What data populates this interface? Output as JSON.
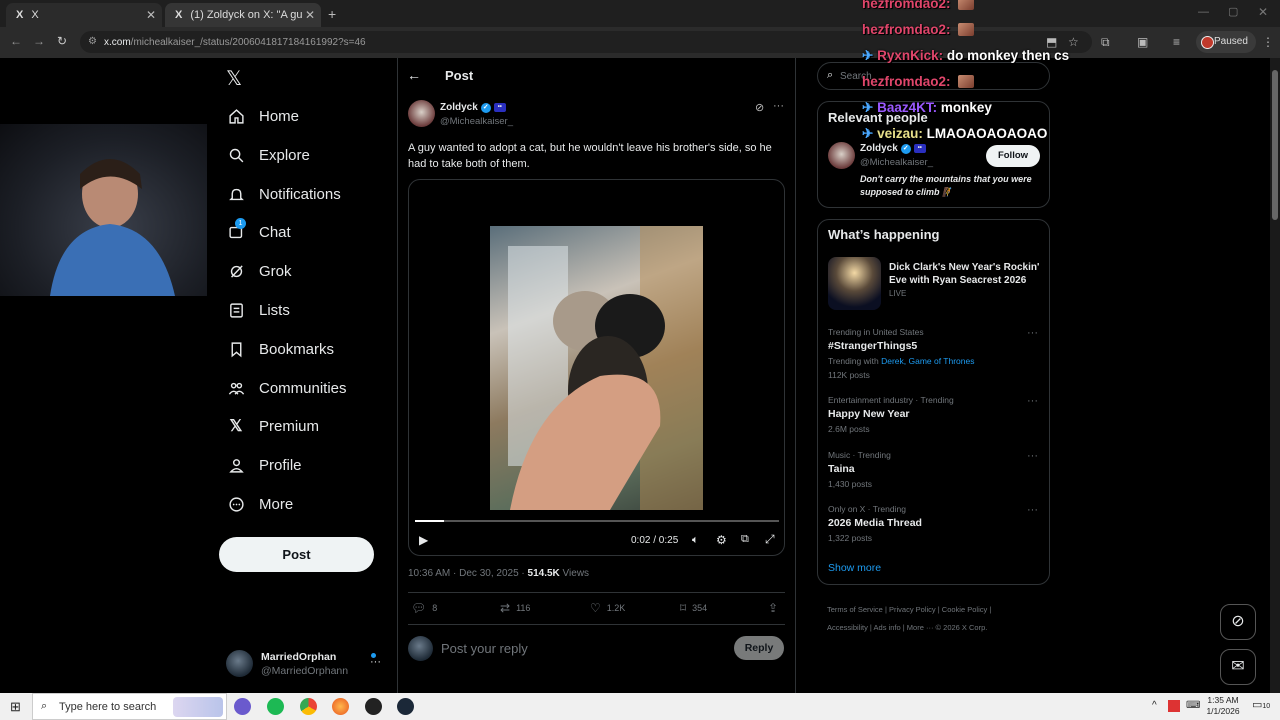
{
  "browser": {
    "tabs": [
      {
        "logo": "X",
        "title": "X",
        "active": false
      },
      {
        "logo": "X",
        "title": "(1) Zoldyck on X: \"A guy wante",
        "active": true
      }
    ],
    "url_host": "x.com",
    "url_path": "/micheal",
    "url_rest": "kaiser_/status/2006041817184161992?s=46",
    "profile_status": "Paused"
  },
  "chat_overlay": [
    {
      "user": "hezfromdao2:",
      "message": "",
      "color": "#e0466b",
      "emote": true,
      "prefix": ""
    },
    {
      "user": "hezfromdao2:",
      "message": "",
      "color": "#e0466b",
      "emote": true,
      "prefix": ""
    },
    {
      "user": "RyxnKick:",
      "message": "do monkey then cs",
      "color": "#e0466b",
      "emote": false,
      "prefix": "✈"
    },
    {
      "user": "hezfromdao2:",
      "message": "",
      "color": "#e0466b",
      "emote": true,
      "prefix": ""
    },
    {
      "user": "Baaz4KT:",
      "message": "monkey",
      "color": "#9b59ff",
      "emote": false,
      "prefix": "✈"
    },
    {
      "user": "veizau:",
      "message": "LMAOAOAOAOAO",
      "color": "#e8e08a",
      "emote": false,
      "prefix": "✈"
    }
  ],
  "sidebar": {
    "logo": "𝕏",
    "items": [
      {
        "label": "Home",
        "icon": "home-icon"
      },
      {
        "label": "Explore",
        "icon": "search-icon"
      },
      {
        "label": "Notifications",
        "icon": "bell-icon"
      },
      {
        "label": "Chat",
        "icon": "chat-icon",
        "badge": "1"
      },
      {
        "label": "Grok",
        "icon": "grok-icon"
      },
      {
        "label": "Lists",
        "icon": "list-icon"
      },
      {
        "label": "Bookmarks",
        "icon": "bookmark-icon"
      },
      {
        "label": "Communities",
        "icon": "communities-icon"
      },
      {
        "label": "Premium",
        "icon": "x-premium-icon"
      },
      {
        "label": "Profile",
        "icon": "profile-icon"
      },
      {
        "label": "More",
        "icon": "more-circle-icon"
      }
    ],
    "post_button": "Post",
    "account": {
      "name": "MarriedOrphan",
      "handle": "@MarriedOrphann"
    }
  },
  "post": {
    "header_title": "Post",
    "author_name": "Zoldyck",
    "author_handle": "@Michealkaiser_",
    "text": "A guy wanted to adopt a cat, but he wouldn't leave his brother's side, so he had to take both of them.",
    "video_time": "0:02 / 0:25",
    "video_progress": 0.08,
    "timestamp": "10:36 AM · Dec 30, 2025 · ",
    "views_count": "514.5K",
    "views_label": "Views",
    "replies": "8",
    "reposts": "116",
    "likes": "1.2K",
    "bookmarks": "354",
    "reply_placeholder": "Post your reply",
    "reply_button": "Reply"
  },
  "right": {
    "search_placeholder": "Search",
    "relevant_title": "Relevant people",
    "relevant_person": {
      "name": "Zoldyck",
      "handle": "@Michealkaiser_",
      "bio": "Don't carry the mountains that you were supposed to climb 🧗",
      "follow_label": "Follow"
    },
    "happening_title": "What’s happening",
    "live_event": {
      "title": "Dick Clark's New Year's Rockin' Eve with Ryan Seacrest 2026",
      "status": "LIVE"
    },
    "trends": [
      {
        "category": "Trending in United States",
        "name": "#StrangerThings5",
        "with_label": "Trending with",
        "with": "Derek, Game of Thrones",
        "count": "112K posts"
      },
      {
        "category": "Entertainment industry · Trending",
        "name": "Happy New Year",
        "count": "2.6M posts"
      },
      {
        "category": "Music · Trending",
        "name": "Taina",
        "count": "1,430 posts"
      },
      {
        "category": "Only on X · Trending",
        "name": "2026 Media Thread",
        "count": "1,322 posts"
      }
    ],
    "show_more": "Show more",
    "footer": {
      "links": [
        "Terms of Service",
        "Privacy Policy",
        "Cookie Policy",
        "Accessibility",
        "Ads info",
        "More ···"
      ],
      "copyright": "© 2026 X Corp."
    }
  },
  "taskbar": {
    "search_placeholder": "Type here to search",
    "time": "1:35 AM",
    "date": "1/1/2026",
    "notification_count": "10"
  }
}
